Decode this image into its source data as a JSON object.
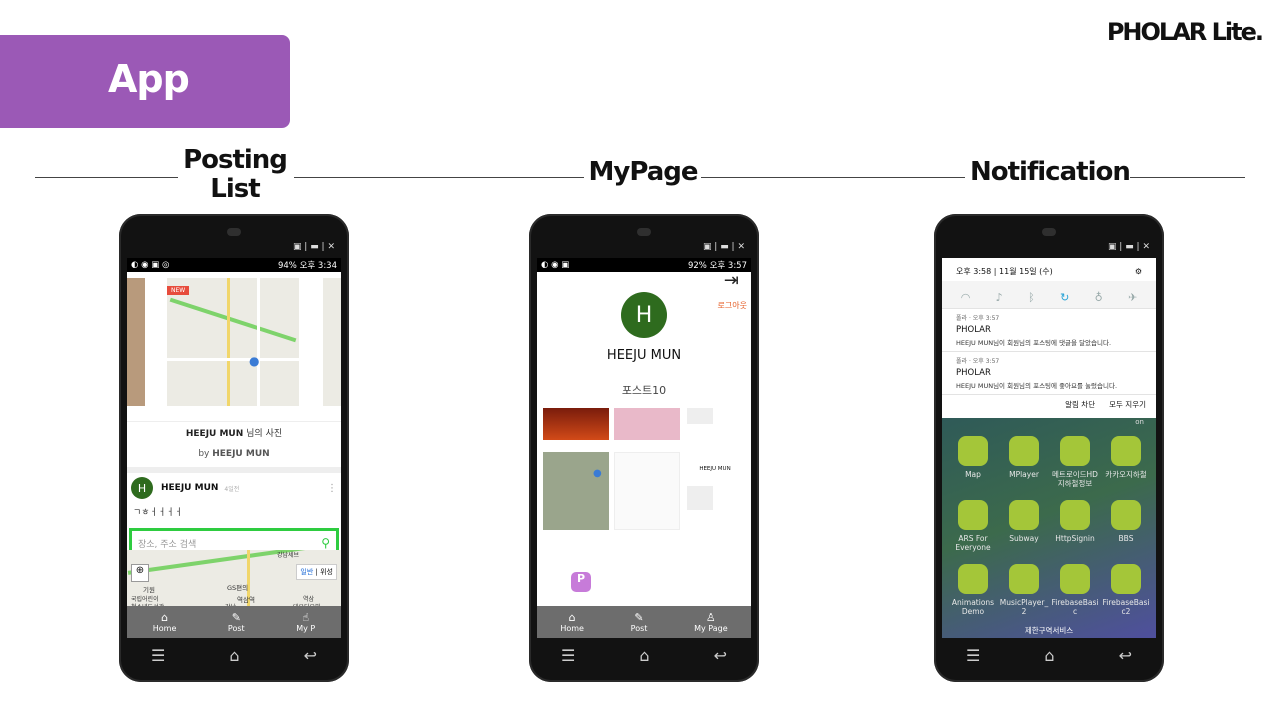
{
  "brand": "PHOLAR Lite.",
  "banner": "App",
  "sections": [
    {
      "title_line1": "Posting",
      "title_line2": "List"
    },
    {
      "title_line1": "MyPage"
    },
    {
      "title_line1": "Notification"
    }
  ],
  "phone1": {
    "status_left": "◐ ◉ ▣ ◎",
    "status_right": "94% 오후 3:34",
    "new_badge": "NEW",
    "caption_name": "HEEJU MUN",
    "caption_suffix": "님의 사진",
    "by_label": "by",
    "by_name": "HEEJU MUN",
    "post_user": "HEEJU MUN",
    "post_time": "4일전",
    "post_text": "ㄱㅎㅓㅓㅓㅓ",
    "search_placeholder": "장소, 주소 검색",
    "map_labels": [
      "기원",
      "GS편의",
      "역삼역",
      "국립어린이",
      "청소년도서관",
      "강남",
      "역삼",
      "대우디오빌",
      "강남세브"
    ],
    "map_toggle": [
      "일반",
      "위성"
    ],
    "tabs": [
      "Home",
      "Post",
      "My P"
    ]
  },
  "phone2": {
    "status_right": "92% 오후 3:57",
    "logout_label": "로그아웃",
    "avatar_letter": "H",
    "name": "HEEJU MUN",
    "posts_label": "포스트10",
    "mini_name": "HEEJU MUN",
    "tabs": [
      "Home",
      "Post",
      "My Page"
    ]
  },
  "phone3": {
    "time": "오후 3:58",
    "date": "11월 15일 (수)",
    "notifications": [
      {
        "app": "폴라",
        "time": "오후 3:57",
        "title": "PHOLAR",
        "body": "HEEJU MUN님이 회원님의 포스팅에 댓글을 달았습니다."
      },
      {
        "app": "폴라",
        "time": "오후 3:57",
        "title": "PHOLAR",
        "body": "HEEJU MUN님이 회원님의 포스팅에 좋아요를 눌렀습니다."
      }
    ],
    "actions": [
      "알림 차단",
      "모두 지우기"
    ],
    "apps": [
      {
        "label": "Map"
      },
      {
        "label": "MPlayer"
      },
      {
        "label": "메트로이드HD 지하철정보"
      },
      {
        "label": "카카오지하철"
      },
      {
        "label": "ARS For Everyone"
      },
      {
        "label": "Subway"
      },
      {
        "label": "HttpSignin"
      },
      {
        "label": "BBS"
      },
      {
        "label": "Animations Demo"
      },
      {
        "label": "MusicPlayer_ 2"
      },
      {
        "label": "FirebaseBasi c"
      },
      {
        "label": "FirebaseBasi c2"
      }
    ],
    "top_partial": "on",
    "carrier": "제한구역서비스"
  },
  "colors": {
    "banner": "#9b59b6",
    "search_border": "#2ecc40",
    "avatar": "#2e6b1e",
    "logout": "#e55a20"
  }
}
